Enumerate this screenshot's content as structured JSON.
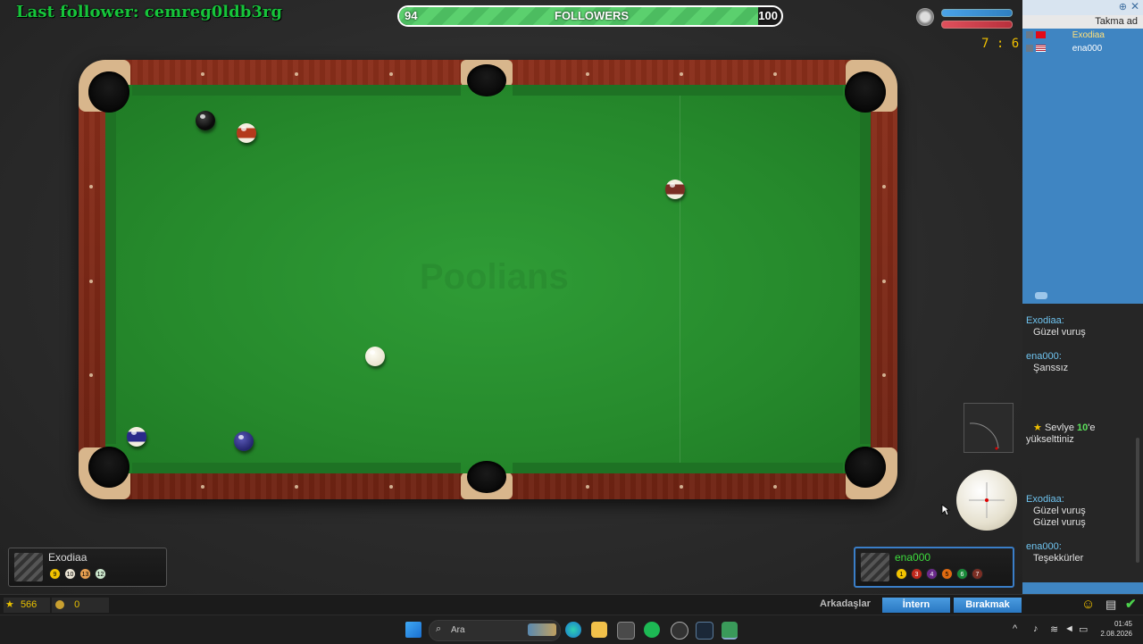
{
  "overlay": {
    "last_follower": "Last follower: cemreg0ldb3rg",
    "followers_label": "FOLLOWERS",
    "followers_current": "94",
    "followers_goal": "100",
    "followers_progress": 0.94
  },
  "game": {
    "score": "7 : 6",
    "watermark": "Poolians",
    "player_left": {
      "name": "Exodiaa",
      "balls": [
        "9",
        "10",
        "13",
        "12"
      ]
    },
    "player_right": {
      "name": "ena000",
      "balls": [
        "1",
        "3",
        "4",
        "5",
        "6",
        "7"
      ]
    }
  },
  "sidebar": {
    "header": "Takma ad",
    "players": [
      {
        "name": "Exodiaa",
        "flag": "TR"
      },
      {
        "name": "ena000",
        "flag": "US"
      }
    ]
  },
  "chat": {
    "m1_user": "Exodiaa:",
    "m1_text": "Güzel vuruş",
    "m2_user": "ena000:",
    "m2_text": "Şanssız",
    "level_pre": "Sevlye",
    "level_num": "10",
    "level_post": "'e",
    "level_line2": "yükselttiniz",
    "m3_user": "Exodiaa:",
    "m3_text1": "Güzel vuruş",
    "m3_text2": "Güzel vuruş",
    "m4_user": "ena000:",
    "m4_text": "Teşekkürler"
  },
  "bottom": {
    "stars": "566",
    "coins": "0",
    "friends": "Arkadaşlar",
    "intern": "İntern",
    "leave": "Bırakmak"
  },
  "taskbar": {
    "search": "Ara",
    "time": "01:45",
    "date": "2.08.2026"
  }
}
